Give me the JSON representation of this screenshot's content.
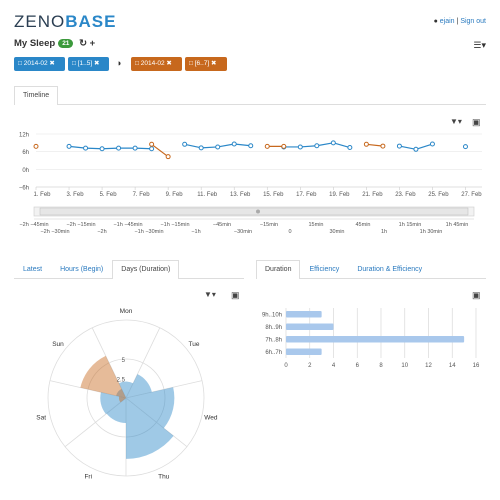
{
  "header": {
    "logo_left": "ZENO",
    "logo_right": "BASE",
    "user": "ejain",
    "separator": "|",
    "signout": "Sign out",
    "title": "My Sleep",
    "count": "21",
    "refresh_icon": "refresh-icon",
    "add_icon": "plus-icon",
    "menu_icon": "hamburger-menu-icon"
  },
  "filters": {
    "blue": [
      "2014-02",
      "[1..5]"
    ],
    "orange": [
      "2014-02",
      "[6..7]"
    ],
    "contrast_icon": "half-circle-icon",
    "colors": {
      "blue": "#2a87c8",
      "orange": "#c7681d"
    }
  },
  "timeline": {
    "tab": "Timeline",
    "y_ticks": [
      "12h",
      "6h",
      "0h",
      "−6h"
    ],
    "x_ticks": [
      "1. Feb",
      "3. Feb",
      "5. Feb",
      "7. Feb",
      "9. Feb",
      "11. Feb",
      "13. Feb",
      "15. Feb",
      "17. Feb",
      "19. Feb",
      "21. Feb",
      "23. Feb",
      "25. Feb",
      "27. Feb"
    ],
    "nav_ticks_top": [
      "−2h −45min",
      "−2h −15min",
      "−1h −45min",
      "−1h −15min",
      "−45min",
      "−15min",
      "15min",
      "45min",
      "1h 15min",
      "1h 45min"
    ],
    "nav_ticks_bottom": [
      "−2h −30min",
      "−2h",
      "−1h −30min",
      "−1h",
      "−30min",
      "0",
      "30min",
      "1h",
      "1h 30min"
    ]
  },
  "chart_data": [
    {
      "type": "line",
      "title": "",
      "xlabel": "",
      "ylabel": "",
      "ylim": [
        -6,
        12
      ],
      "x_range": [
        1,
        28
      ],
      "series": [
        {
          "color": "#2a87c8",
          "points": [
            [
              3,
              7.8
            ],
            [
              4,
              7.2
            ],
            [
              5,
              7.0
            ],
            [
              6,
              7.2
            ],
            [
              7,
              7.2
            ],
            [
              8,
              7.0
            ],
            [
              10,
              8.5
            ],
            [
              11,
              7.3
            ],
            [
              12,
              7.6
            ],
            [
              13,
              8.6
            ],
            [
              14,
              8.0
            ],
            [
              16,
              7.6
            ],
            [
              17,
              7.6
            ],
            [
              18,
              8.0
            ],
            [
              19,
              9.0
            ],
            [
              20,
              7.4
            ],
            [
              23,
              7.9
            ],
            [
              24,
              6.8
            ],
            [
              25,
              8.6
            ],
            [
              27,
              7.7
            ]
          ]
        },
        {
          "color": "#c7681d",
          "points": [
            [
              1,
              7.8
            ],
            [
              8,
              8.5
            ],
            [
              9,
              4.3
            ],
            [
              15,
              7.8
            ],
            [
              16,
              7.8
            ],
            [
              21,
              8.5
            ],
            [
              22,
              7.9
            ]
          ]
        }
      ]
    },
    {
      "type": "bar",
      "title": "",
      "radial": true,
      "categories": [
        "Mon",
        "Tue",
        "Wed",
        "Thu",
        "Fri",
        "Sat",
        "Sun"
      ],
      "radial_ticks": [
        "2.5",
        "5"
      ],
      "ylim": [
        0,
        10
      ],
      "series": [
        {
          "color": "#2a87c8",
          "values": [
            2.1,
            3.4,
            6.2,
            7.8,
            3.2,
            3.3,
            1.3
          ]
        },
        {
          "color": "#c7681d",
          "values": [
            0,
            0,
            0,
            0,
            0,
            0.9,
            6.0
          ]
        }
      ]
    },
    {
      "type": "bar",
      "title": "",
      "orientation": "horizontal",
      "categories": [
        "9h..10h",
        "8h..9h",
        "7h..8h",
        "6h..7h"
      ],
      "values": [
        3,
        4,
        15,
        3
      ],
      "x_ticks": [
        "0",
        "2",
        "4",
        "6",
        "8",
        "10",
        "12",
        "14",
        "16"
      ],
      "xlim": [
        0,
        16
      ],
      "color": "#a9c8ec"
    }
  ],
  "left_panel": {
    "tabs": [
      "Latest",
      "Hours (Begin)",
      "Days (Duration)"
    ],
    "active": 2
  },
  "right_panel": {
    "tabs": [
      "Duration",
      "Efficiency",
      "Duration & Efficiency"
    ],
    "active": 0
  },
  "icons": {
    "filter": "filter-icon",
    "camera": "camera-icon",
    "calendar": "calendar-icon",
    "remove": "remove-x-icon",
    "user": "user-icon"
  }
}
